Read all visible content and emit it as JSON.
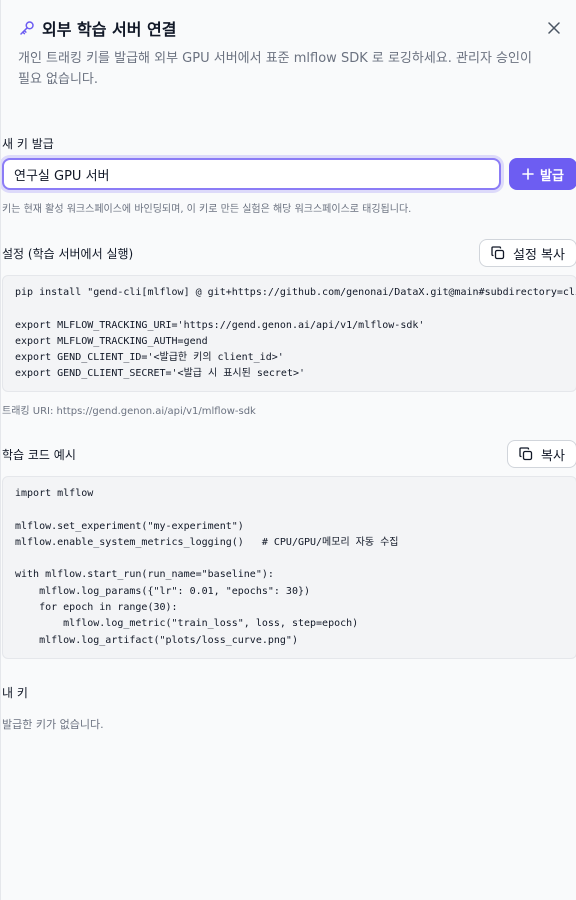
{
  "header": {
    "title": "외부 학습 서버 연결",
    "subtitle": "개인 트래킹 키를 발급해 외부 GPU 서버에서 표준 mlflow SDK 로 로깅하세요. 관리자 승인이 필요 없습니다."
  },
  "new_key": {
    "label": "새 키 발급",
    "input_value": "연구실 GPU 서버",
    "issue_button": "발급",
    "hint": "키는 현재 활성 워크스페이스에 바인딩되며, 이 키로 만든 실험은 해당 워크스페이스로 태깅됩니다."
  },
  "setup": {
    "label": "설정 (학습 서버에서 실행)",
    "copy_button": "설정 복사",
    "code": "pip install \"gend-cli[mlflow] @ git+https://github.com/genonai/DataX.git@main#subdirectory=cli\"\n\nexport MLFLOW_TRACKING_URI='https://gend.genon.ai/api/v1/mlflow-sdk'\nexport MLFLOW_TRACKING_AUTH=gend\nexport GEND_CLIENT_ID='<발급한 키의 client_id>'\nexport GEND_CLIENT_SECRET='<발급 시 표시된 secret>'",
    "tracking_uri": "트래킹 URI: https://gend.genon.ai/api/v1/mlflow-sdk"
  },
  "example": {
    "label": "학습 코드 예시",
    "copy_button": "복사",
    "code": "import mlflow\n\nmlflow.set_experiment(\"my-experiment\")\nmlflow.enable_system_metrics_logging()   # CPU/GPU/메모리 자동 수집\n\nwith mlflow.start_run(run_name=\"baseline\"):\n    mlflow.log_params({\"lr\": 0.01, \"epochs\": 30})\n    for epoch in range(30):\n        mlflow.log_metric(\"train_loss\", loss, step=epoch)\n    mlflow.log_artifact(\"plots/loss_curve.png\")"
  },
  "my_keys": {
    "label": "내 키",
    "empty": "발급한 키가 없습니다."
  },
  "colors": {
    "accent": "#6d5df2",
    "focus_border": "#8b7cf6"
  },
  "icons": [
    "key-icon",
    "close-icon",
    "plus-icon",
    "copy-icon"
  ]
}
